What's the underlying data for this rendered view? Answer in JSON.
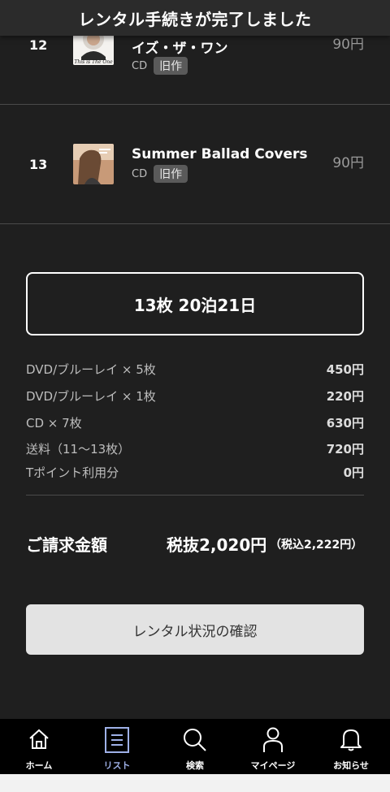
{
  "toast": {
    "message": "レンタル手続きが完了しました"
  },
  "items": [
    {
      "number": "12",
      "title": "イズ・ザ・ワン",
      "format": "CD",
      "badge": "旧作",
      "price": "90円",
      "thumb_text": "This is The One"
    },
    {
      "number": "13",
      "title": "Summer Ballad Covers",
      "format": "CD",
      "badge": "旧作",
      "price": "90円"
    }
  ],
  "summary": {
    "box_text": "13枚 20泊21日"
  },
  "breakdown": [
    {
      "label": "DVD/ブルーレイ × 5枚",
      "amount": "450円"
    },
    {
      "label": "DVD/ブルーレイ × 1枚",
      "amount": "220円"
    },
    {
      "label": "CD × 7枚",
      "amount": "630円"
    },
    {
      "label": "送料（11〜13枚）",
      "amount": "720円"
    },
    {
      "label": "Tポイント利用分",
      "amount": "0円"
    }
  ],
  "total": {
    "label": "ご請求金額",
    "excl_tax": "税抜2,020円",
    "incl_tax": "（税込2,222円）"
  },
  "status_button": {
    "label": "レンタル状況の確認"
  },
  "tabs": [
    {
      "label": "ホーム",
      "icon": "home-icon"
    },
    {
      "label": "リスト",
      "icon": "list-icon",
      "active": true
    },
    {
      "label": "検索",
      "icon": "search-icon"
    },
    {
      "label": "マイページ",
      "icon": "person-icon"
    },
    {
      "label": "お知らせ",
      "icon": "bell-icon"
    }
  ],
  "colors": {
    "background": "#1f1f1f",
    "active_tab": "#9fb1e8",
    "button": "#e3e3e3",
    "badge": "#5a5a5a"
  }
}
